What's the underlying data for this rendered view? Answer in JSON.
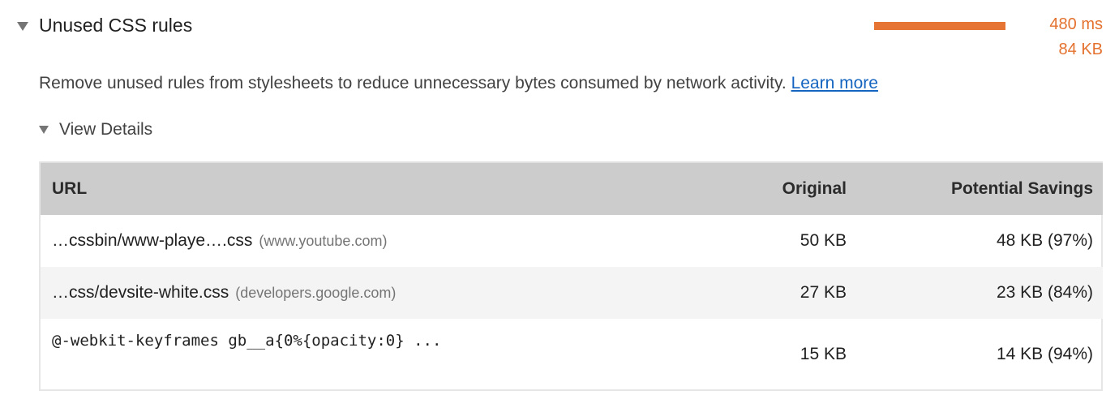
{
  "audit": {
    "title": "Unused CSS rules",
    "metric_ms": "480 ms",
    "metric_kb": "84 KB",
    "savings_bar_fraction": 1.0,
    "accent_color": "#e67432",
    "description": "Remove unused rules from stylesheets to reduce unnecessary bytes consumed by network activity.",
    "learn_more": "Learn more",
    "toggle_icon": "triangle-down-icon"
  },
  "details": {
    "toggle_label": "View Details",
    "toggle_icon": "triangle-down-icon",
    "columns": {
      "url": "URL",
      "original": "Original",
      "savings": "Potential Savings"
    },
    "rows": [
      {
        "url": "…cssbin/www-playe….css",
        "host": "(www.youtube.com)",
        "original": "50 KB",
        "savings": "48 KB (97%)"
      },
      {
        "url": "…css/devsite-white.css",
        "host": "(developers.google.com)",
        "original": "27 KB",
        "savings": "23 KB (84%)"
      },
      {
        "url": "@-webkit-keyframes gb__a{0%{opacity:0} ...",
        "host": "",
        "original": "15 KB",
        "savings": "14 KB (94%)"
      }
    ]
  }
}
